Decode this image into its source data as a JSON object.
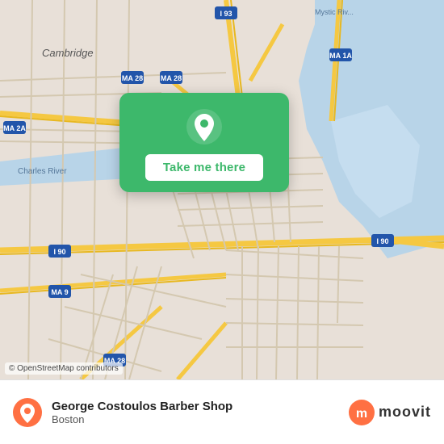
{
  "map": {
    "attribution": "© OpenStreetMap contributors"
  },
  "popup": {
    "button_label": "Take me there"
  },
  "bottom_bar": {
    "place_name": "George Costoulos Barber Shop",
    "place_city": "Boston",
    "moovit_text": "moovit"
  }
}
